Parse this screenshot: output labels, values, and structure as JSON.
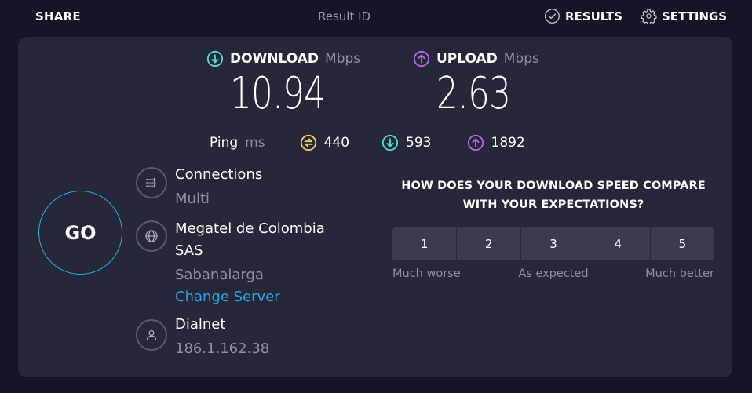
{
  "header": {
    "share_label": "SHARE",
    "result_id_label": "Result ID",
    "results_label": "RESULTS",
    "results_icon": "check-circle-icon",
    "settings_label": "SETTINGS",
    "settings_icon": "gear-icon"
  },
  "metrics": {
    "download": {
      "label": "DOWNLOAD",
      "unit": "Mbps",
      "value": "10.94",
      "icon": "arrow-down-circle-icon",
      "color": "#4ee0d3"
    },
    "upload": {
      "label": "UPLOAD",
      "unit": "Mbps",
      "value": "2.63",
      "icon": "arrow-up-circle-icon",
      "color": "#b66ae6"
    }
  },
  "ping": {
    "label": "Ping",
    "unit": "ms",
    "idle": {
      "value": "440",
      "icon": "idle-latency-icon",
      "color": "#f2d15a"
    },
    "download": {
      "value": "593",
      "icon": "arrow-down-circle-icon",
      "color": "#4ee0d3"
    },
    "upload": {
      "value": "1892",
      "icon": "arrow-up-circle-icon",
      "color": "#b66ae6"
    }
  },
  "go_button": {
    "label": "GO",
    "ring_color": "#1fb6d6"
  },
  "connections": {
    "title": "Connections",
    "value": "Multi",
    "icon": "connections-icon"
  },
  "server": {
    "title_line1": "Megatel de Colombia",
    "title_line2": "SAS",
    "location": "Sabanalarga",
    "change_label": "Change Server",
    "icon": "globe-icon",
    "link_color": "#1ea7e8"
  },
  "isp": {
    "title": "Dialnet",
    "ip": "186.1.162.38",
    "icon": "user-icon"
  },
  "survey": {
    "question": "HOW DOES YOUR DOWNLOAD SPEED COMPARE WITH YOUR EXPECTATIONS?",
    "options": [
      "1",
      "2",
      "3",
      "4",
      "5"
    ],
    "scale_left": "Much worse",
    "scale_mid": "As expected",
    "scale_right": "Much better"
  }
}
